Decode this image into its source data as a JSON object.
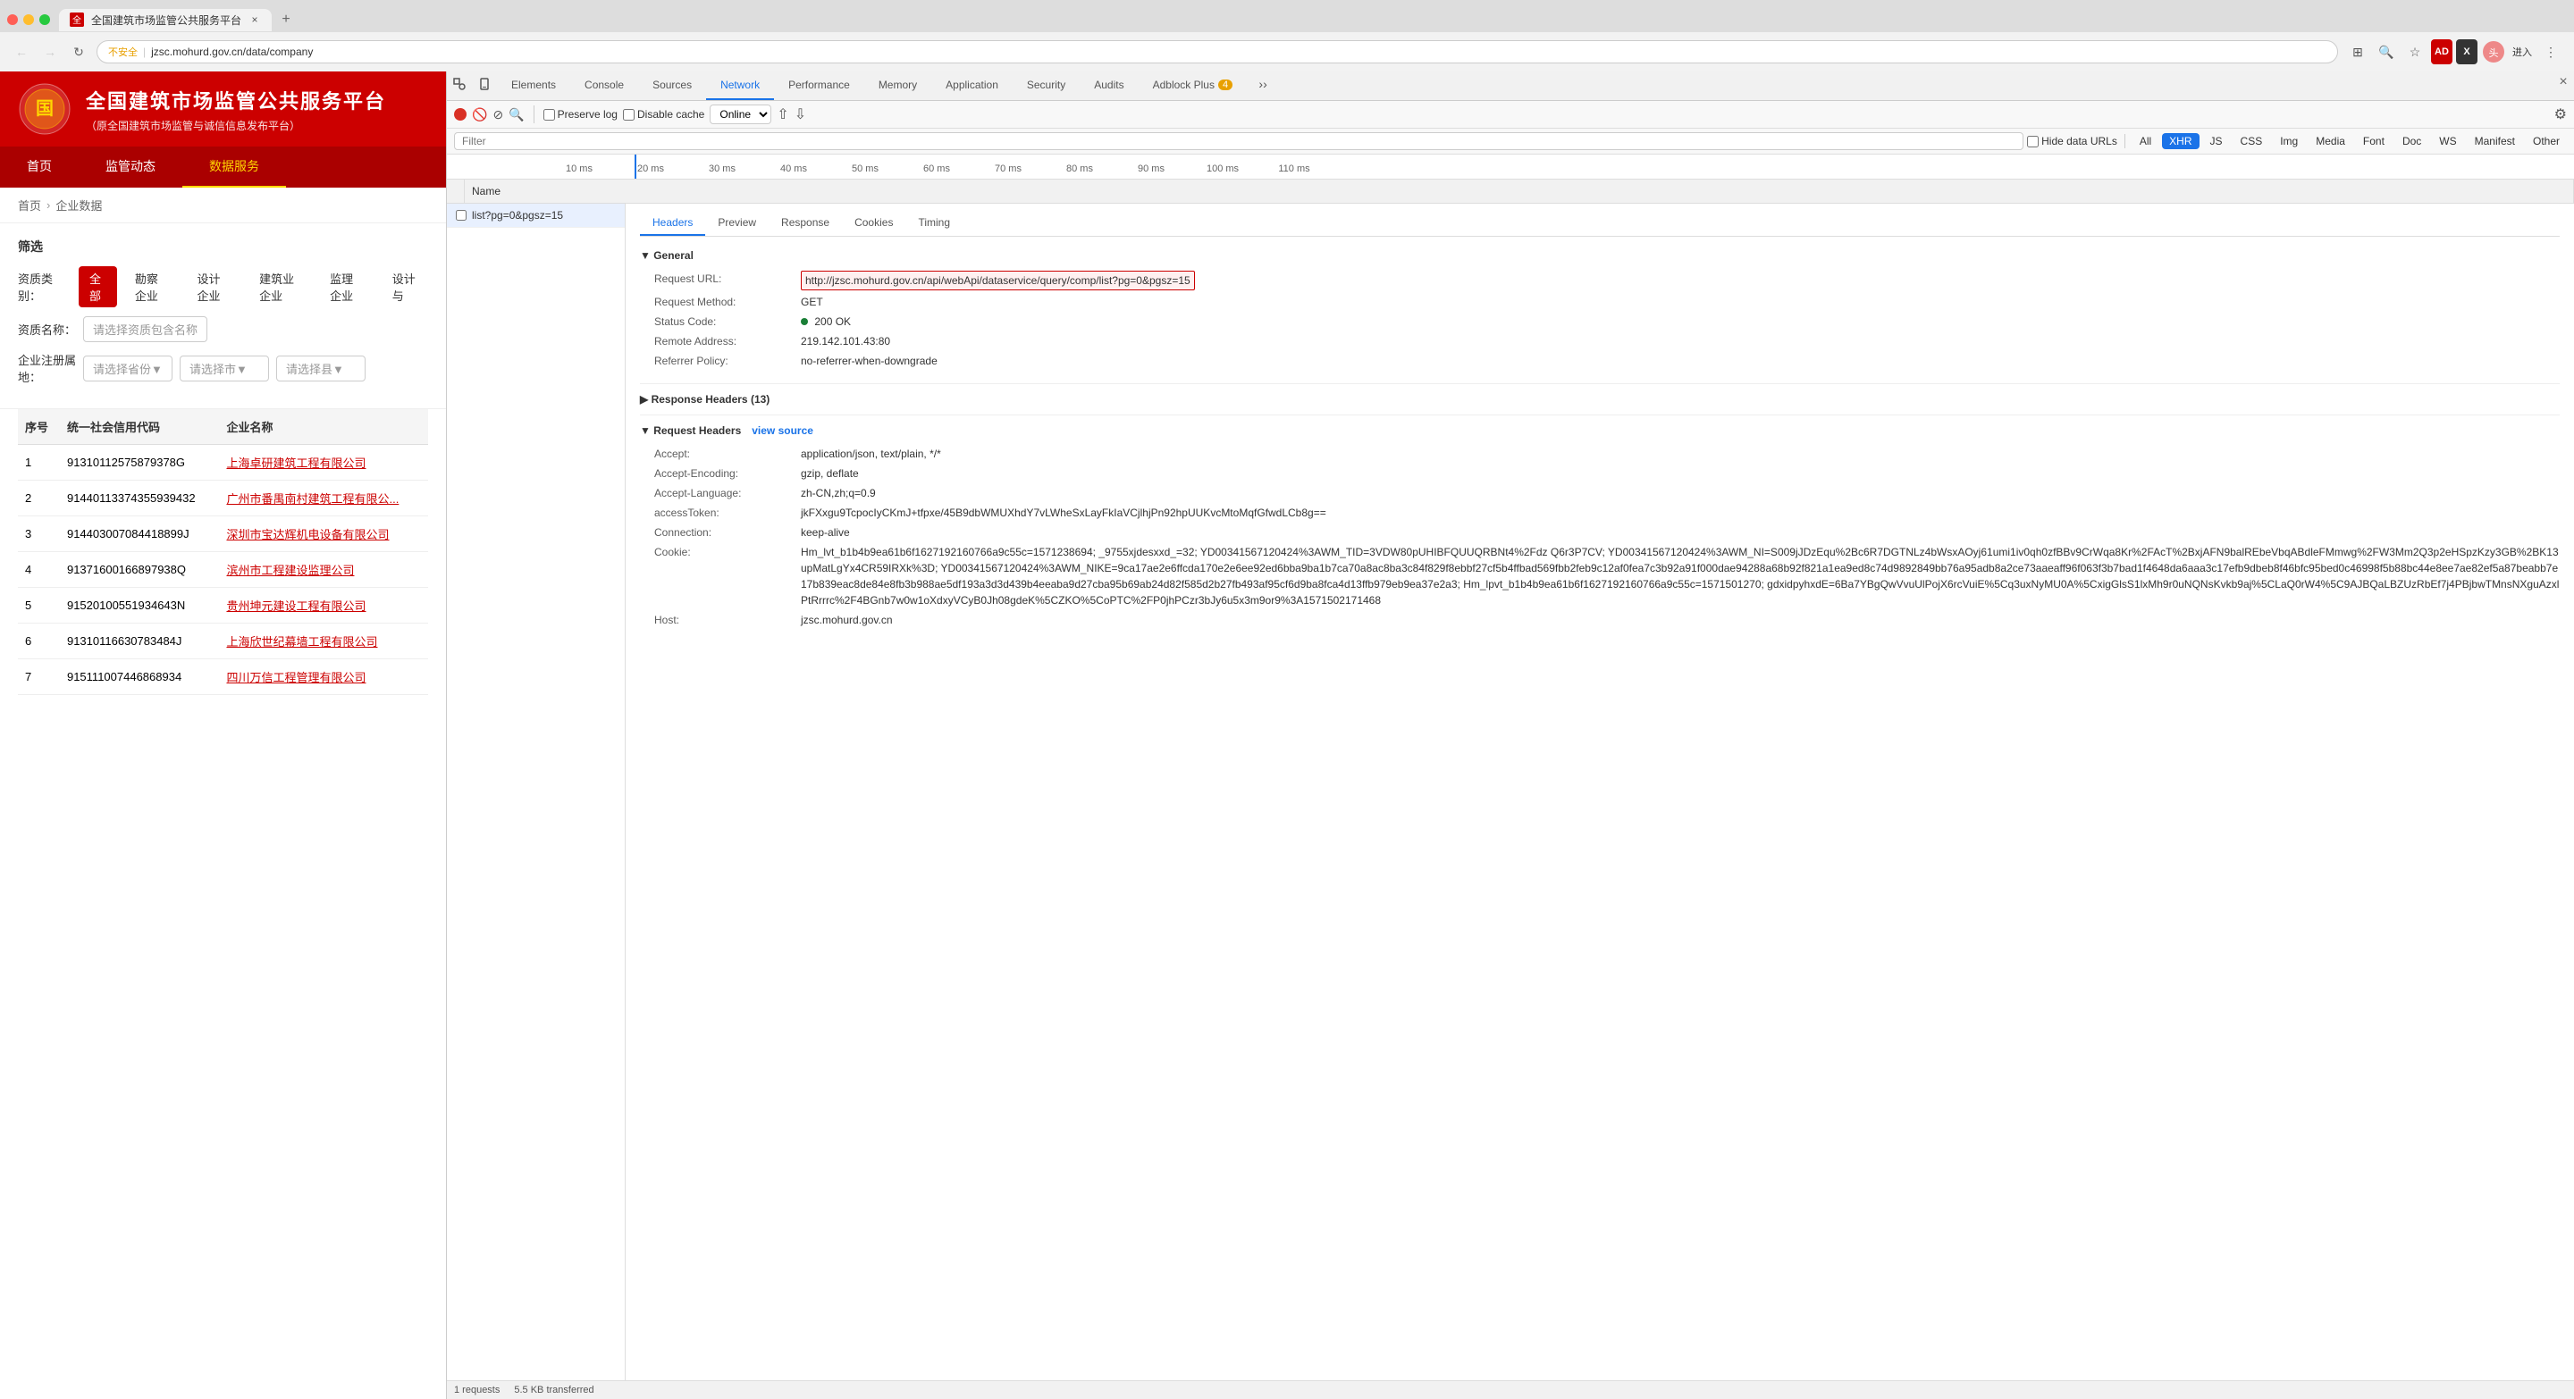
{
  "browser": {
    "tab_title": "全国建筑市场监管公共服务平台",
    "tab_close": "×",
    "tab_new": "+",
    "address_warning": "不安全",
    "address_separator": "|",
    "address_url": "jzsc.mohurd.gov.cn/data/company",
    "nav_more": "⋮",
    "user_label": "进入"
  },
  "website": {
    "header_title": "全国建筑市场监管公共服务平台",
    "header_subtitle": "（原全国建筑市场监管与诚信信息发布平台）",
    "nav_items": [
      "首页",
      "监管动态",
      "数据服务"
    ],
    "nav_active": "数据服务",
    "breadcrumb_home": "首页",
    "breadcrumb_current": "企业数据",
    "filter_title": "筛选",
    "filter_qual_label": "资质类别：",
    "filter_qual_all": "全部",
    "filter_qual_tags": [
      "勘察企业",
      "设计企业",
      "建筑业企业",
      "监理企业",
      "设计与"
    ],
    "filter_name_label": "资质名称：",
    "filter_name_placeholder": "请选择资质包含名称",
    "filter_province_placeholder": "请选择省份▼",
    "filter_city_placeholder": "请选择市▼",
    "filter_county_placeholder": "请选择县▼",
    "filter_reg_label": "企业注册属\n地：",
    "table_headers": [
      "序号",
      "统一社会信用代码",
      "企业名称"
    ],
    "table_rows": [
      {
        "no": "1",
        "code": "91310112575879378G",
        "name": "上海卓研建筑工程有限公司"
      },
      {
        "no": "2",
        "code": "91440113374355939432",
        "name": "广州市番禺南村建筑工程有限公..."
      },
      {
        "no": "3",
        "code": "914403007084418899J",
        "name": "深圳市宝达辉机电设备有限公司"
      },
      {
        "no": "4",
        "code": "91371600166897938Q",
        "name": "滨州市工程建设监理公司"
      },
      {
        "no": "5",
        "code": "91520100551934643N",
        "name": "贵州坤元建设工程有限公司"
      },
      {
        "no": "6",
        "code": "91310116630783484J",
        "name": "上海欣世纪幕墙工程有限公司"
      },
      {
        "no": "7",
        "code": "915111007446868934",
        "name": "四川万信工程管理有限公司"
      }
    ]
  },
  "devtools": {
    "tabs": [
      "Elements",
      "Console",
      "Sources",
      "Network",
      "Performance",
      "Memory",
      "Application",
      "Security",
      "Audits",
      "Adblock Plus"
    ],
    "active_tab": "Network",
    "adblock_count": "4",
    "close_btn": "×",
    "toolbar_icons": {
      "record": "●",
      "clear": "🚫",
      "filter": "⊘",
      "search": "🔍"
    },
    "preserve_log_label": "Preserve log",
    "disable_cache_label": "Disable cache",
    "online_options": [
      "Online"
    ],
    "filter_types": [
      "All",
      "XHR",
      "JS",
      "CSS",
      "Img",
      "Media",
      "Font",
      "Doc",
      "WS",
      "Manifest",
      "Other"
    ],
    "active_filter_type": "XHR",
    "hide_data_urls": "Hide data URLs",
    "timeline_labels": [
      "10 ms",
      "20 ms",
      "30 ms",
      "40 ms",
      "50 ms",
      "60 ms",
      "70 ms",
      "80 ms",
      "90 ms",
      "100 ms",
      "110 ms"
    ],
    "request_list": [
      {
        "name": "list?pg=0&pgsz=15",
        "selected": true
      }
    ],
    "headers_tabs": [
      "Headers",
      "Preview",
      "Response",
      "Cookies",
      "Timing"
    ],
    "active_headers_tab": "Headers",
    "general_section": {
      "title": "▼ General",
      "request_url_label": "Request URL:",
      "request_url_value": "http://jzsc.mohurd.gov.cn/api/webApi/dataservice/query/comp/list?pg=0&pgsz=15",
      "request_method_label": "Request Method:",
      "request_method_value": "GET",
      "status_code_label": "Status Code:",
      "status_code_value": "200 OK",
      "remote_address_label": "Remote Address:",
      "remote_address_value": "219.142.101.43:80",
      "referrer_policy_label": "Referrer Policy:",
      "referrer_policy_value": "no-referrer-when-downgrade"
    },
    "response_headers_section": {
      "title": "▶ Response Headers (13)"
    },
    "request_headers_section": {
      "title": "▼ Request Headers",
      "view_source": "view source",
      "headers": [
        {
          "key": "Accept:",
          "value": "application/json, text/plain, */*"
        },
        {
          "key": "Accept-Encoding:",
          "value": "gzip, deflate"
        },
        {
          "key": "Accept-Language:",
          "value": "zh-CN,zh;q=0.9"
        },
        {
          "key": "accessToken:",
          "value": "jkFXxgu9TcpocIyCKmJ+tfpxe/45B9dbWMUXhdY7vLWheSxLayFkIaVCjlhjPn92hpUUKvcMtoMqfGfwdLCb8g=="
        },
        {
          "key": "Connection:",
          "value": "keep-alive"
        },
        {
          "key": "Cookie:",
          "value": "Hm_lvt_b1b4b9ea61b6f1627192160766a9c55c=1571238694; _9755xjdesxxd_=32; YD00341567120424%3AWM_TID=3VDW80pUHIBFQUUQRBNt4%2Fdz Q6r3P7CV; YD00341567120424%3AWM_NI=S009jJDzEqu%2Bc6R7DGTNLz4bWsxAOyj61umi1iv0qh0zfBBv9CrWqa8Kr%2FAcT%2BxjAFN9balREbeVbqABdleFMmwg%2FW3Mm2Q3p2eHSpzKzy3GB%2BK13upMatLgYx4CR59IRXk%3D; YD00341567120424%3AWM_NIKE=9ca17ae2e6ffcda170e2e6ee92ed6bba9ba1b7ca70a8ac8ba3c84f829f8ebbf27cf5b4ffbad569fbb2feb9c12af0fea7c3b92a91f000dae94288a68b92f821a1ea9ed8c74d9892849bb76a95adb8a2ce73aaeaff96f063f3b7bad1f4648da6aaa3c17efb9dbeb8f46bfc95bed0c46998f5b88bc44e8ee7ae82ef5a87beabb7e17b839eac8de84e8fb3b988ae5df193a3d3d439b4eeaba9d27cba95b69ab24d82f585d2b27fb493af95cf6d9ba8fca4d13ffb979eb9ea37e2a3; Hm_lpvt_b1b4b9ea61b6f1627192160766a9c55c=1571501270; gdxidpyhxdE=6Ba7YBgQwVvuUlPojX6rcVuiE%5Cq3uxNyMU0A%5CxigGlsS1lxMh9r0uNQNsKvkb9aj%5CLaQ0rW4%5C9AJBQaLBZUzRbEf7j4PBjbwTMnsNXguAzxlPtRrrrc%2F4BGnb7w0w1oXdxyVCyB0Jh08gdeK%5CZKO%5CoPTC%2FP0jhPCzr3bJy6u5x3m9or9%3A1571502171468"
        },
        {
          "key": "Host:",
          "value": "jzsc.mohurd.gov.cn"
        }
      ]
    },
    "status_bar": {
      "requests": "1 requests",
      "transferred": "5.5 KB transferred"
    }
  }
}
